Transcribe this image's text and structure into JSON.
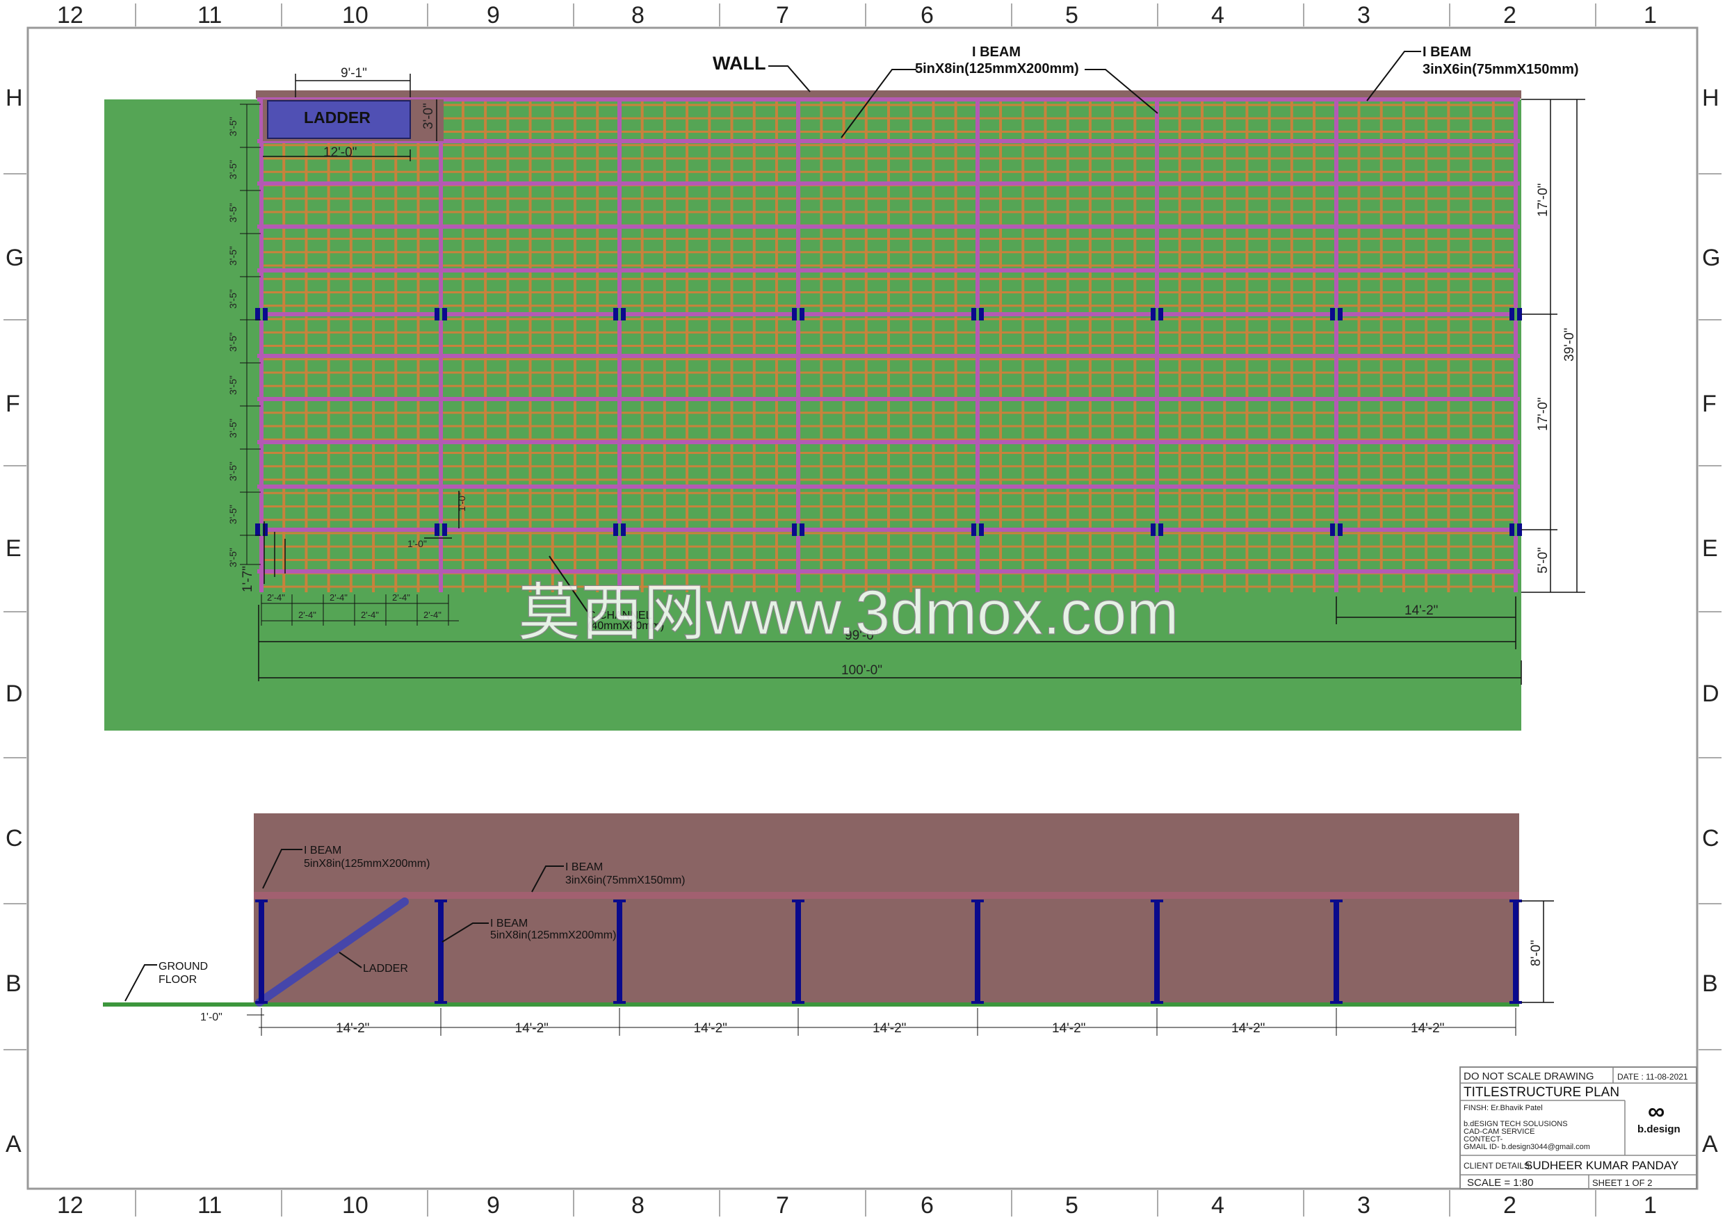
{
  "frame": {
    "columns": [
      "12",
      "11",
      "10",
      "9",
      "8",
      "7",
      "6",
      "5",
      "4",
      "3",
      "2",
      "1"
    ],
    "rows": [
      "H",
      "G",
      "F",
      "E",
      "D",
      "C",
      "B",
      "A"
    ]
  },
  "plan": {
    "wall_label": "WALL",
    "ibeam_main_title": "I BEAM",
    "ibeam_main_size": "5inX8in(125mmX200mm)",
    "ibeam_secondary_title": "I BEAM",
    "ibeam_secondary_size": "3inX6in(75mmX150mm)",
    "ladder_label": "LADDER",
    "ladder_width_dim": "9'-1\"",
    "ladder_len_dim": "12'-0\"",
    "ladder_depth_dim": "3'-0\"",
    "c_channel_line1": "C CHANNEL",
    "c_channel_line2": "(40mmX80mm)",
    "dim_17_top": "17'-0\"",
    "dim_17_bottom": "17'-0\"",
    "dim_39": "39'-0\"",
    "dim_5": "5'-0\"",
    "dim_14_2": "14'-2\"",
    "dim_99": "99'-0\"",
    "dim_100": "100'-0\"",
    "dim_1_0_a": "1'-0\"",
    "dim_1_0_b": "1'-0\"",
    "dim_1_7": "1'-7\"",
    "row_spacing": "3'-5\"",
    "col_spacing": "2'-4\""
  },
  "elevation": {
    "ibeam_top_title": "I BEAM",
    "ibeam_top_size": "5inX8in(125mmX200mm)",
    "ibeam_sec_title": "I BEAM",
    "ibeam_sec_size": "3inX6in(75mmX150mm)",
    "ibeam_col_title": "I BEAM",
    "ibeam_col_size": "5inX8in(125mmX200mm)",
    "ladder_label": "LADDER",
    "ground_line1": "GROUND",
    "ground_line2": "FLOOR",
    "height_dim": "8'-0\"",
    "offset_dim": "1'-0\"",
    "bay_dims": [
      "14'-2\"",
      "14'-2\"",
      "14'-2\"",
      "14'-2\"",
      "14'-2\"",
      "14'-2\"",
      "14'-2\""
    ]
  },
  "watermark": "莫西网www.3dmox.com",
  "title_block": {
    "do_not_scale": "DO NOT SCALE DRAWING",
    "date": "DATE : 11-08-2021",
    "title_prefix": "TITLE:",
    "title": "STRUCTURE PLAN",
    "finsh": "FINSH: Er.Bhavik Patel",
    "company": "b.dESIGN TECH SOLUSIONS",
    "service": "CAD-CAM SERVICE",
    "contact": "CONTECT-",
    "gmail": "GMAIL ID- b.design3044@gmail.com",
    "logo_text": "b.design",
    "logo_symbol": "∞",
    "client_label": "CLIENT DETAILS:",
    "client_name": "SUDHEER KUMAR PANDAY",
    "scale": "SCALE = 1:80",
    "sheet": "SHEET 1 OF 2"
  },
  "colors": {
    "floor_green": "#55a555",
    "wall_brown": "#8a6464",
    "i_beam_main": "#b45ab4",
    "i_beam_secondary": "#c8823c",
    "column_blue": "#0a0a8c",
    "ladder_blue": "#4646aa"
  }
}
